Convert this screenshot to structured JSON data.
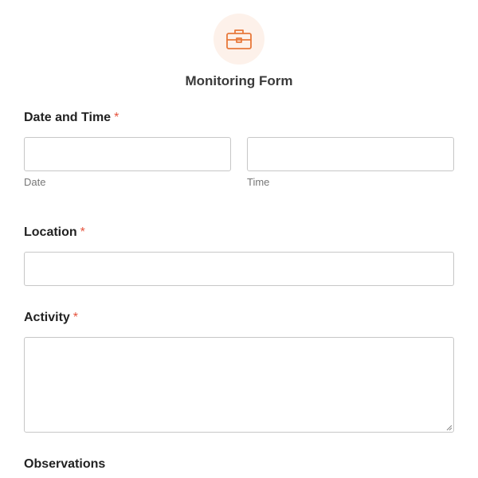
{
  "form": {
    "title": "Monitoring Form",
    "icon": "briefcase-icon",
    "accent_color": "#e8783a",
    "icon_bg_color": "#fdf1ea",
    "required_marker": "*",
    "required_color": "#e5533d"
  },
  "fields": {
    "date_time": {
      "label": "Date and Time",
      "required": true,
      "date_value": "",
      "date_sublabel": "Date",
      "time_value": "",
      "time_sublabel": "Time"
    },
    "location": {
      "label": "Location",
      "required": true,
      "value": ""
    },
    "activity": {
      "label": "Activity",
      "required": true,
      "value": ""
    },
    "observations": {
      "label": "Observations",
      "required": false
    }
  }
}
